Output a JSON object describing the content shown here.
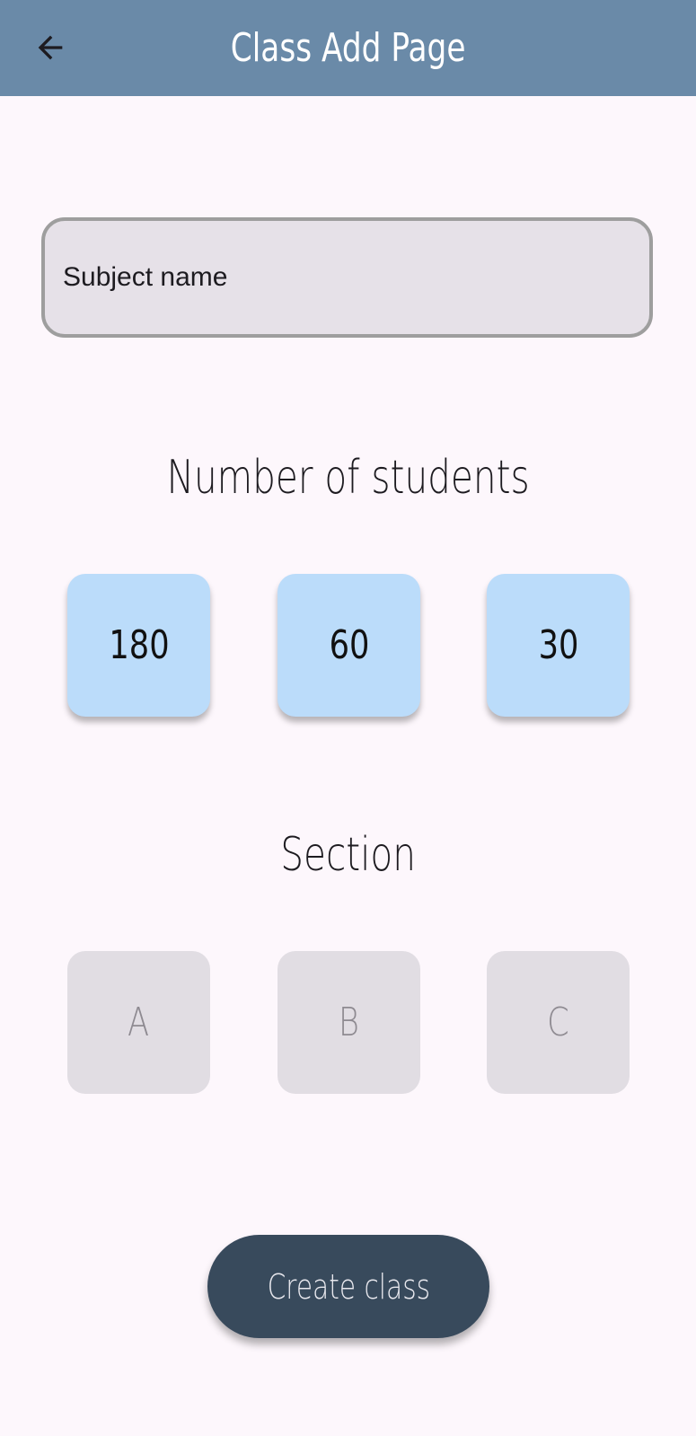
{
  "header": {
    "title": "Class Add Page",
    "back_icon": "arrow-back-icon"
  },
  "form": {
    "subject_placeholder": "Subject name",
    "subject_value": ""
  },
  "students": {
    "heading": "Number of students",
    "options": [
      "180",
      "60",
      "30"
    ]
  },
  "section": {
    "heading": "Section",
    "options": [
      "A",
      "B",
      "C"
    ]
  },
  "actions": {
    "create_label": "Create class"
  },
  "colors": {
    "app_bar": "#6a8aa8",
    "background": "#fdf7fc",
    "student_tile": "#bbdcfa",
    "section_tile": "#e1dde3",
    "create_button": "#384a5c"
  }
}
